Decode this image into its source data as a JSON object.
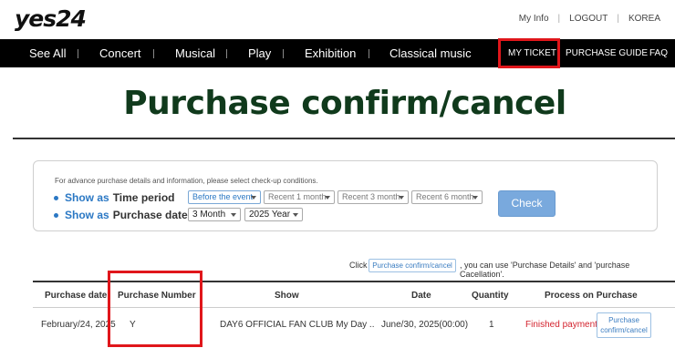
{
  "header": {
    "logo": "yes24",
    "util_links": [
      "My Info",
      "LOGOUT",
      "KOREA"
    ]
  },
  "nav": {
    "items": [
      "See All",
      "Concert",
      "Musical",
      "Play",
      "Exhibition",
      "Classical music"
    ],
    "right": [
      "MY TICKET",
      "PURCHASE GUIDE",
      "FAQ"
    ]
  },
  "page": {
    "title": "Purchase confirm/cancel"
  },
  "filter": {
    "hint": "For advance purchase details and information, please select check-up conditions.",
    "row1": {
      "prefix": "Show as",
      "label": "Time period"
    },
    "row2": {
      "prefix": "Show as",
      "label": "Purchase date"
    },
    "time_options": [
      "Before the event",
      "Recent 1 month",
      "Recent 3 month",
      "Recent 6 month"
    ],
    "month_select": "3 Month",
    "year_select": "2025 Year",
    "check_label": "Check"
  },
  "help": {
    "pre": "Click",
    "button": "Purchase confirm/cancel",
    "post": ", you can use 'Purchase Details' and 'purchase Cacellation'."
  },
  "table": {
    "headers": [
      "Purchase date",
      "Purchase Number",
      "Show",
      "Date",
      "Quantity",
      "Process on Purchase"
    ],
    "row": {
      "purchase_date": "February/24, 2025",
      "purchase_number": "Y",
      "show": "DAY6 OFFICIAL FAN CLUB My Day ..",
      "date": "June/30, 2025(00:00)",
      "quantity": "1",
      "status": "Finished payment",
      "action": [
        "Purchase",
        "confirm/cancel"
      ]
    }
  },
  "colors": {
    "nav_bg": "#000000",
    "title": "#103a1c",
    "accent_blue": "#2b78c4",
    "highlight": "#e0161b",
    "status_red": "#d3232e"
  }
}
